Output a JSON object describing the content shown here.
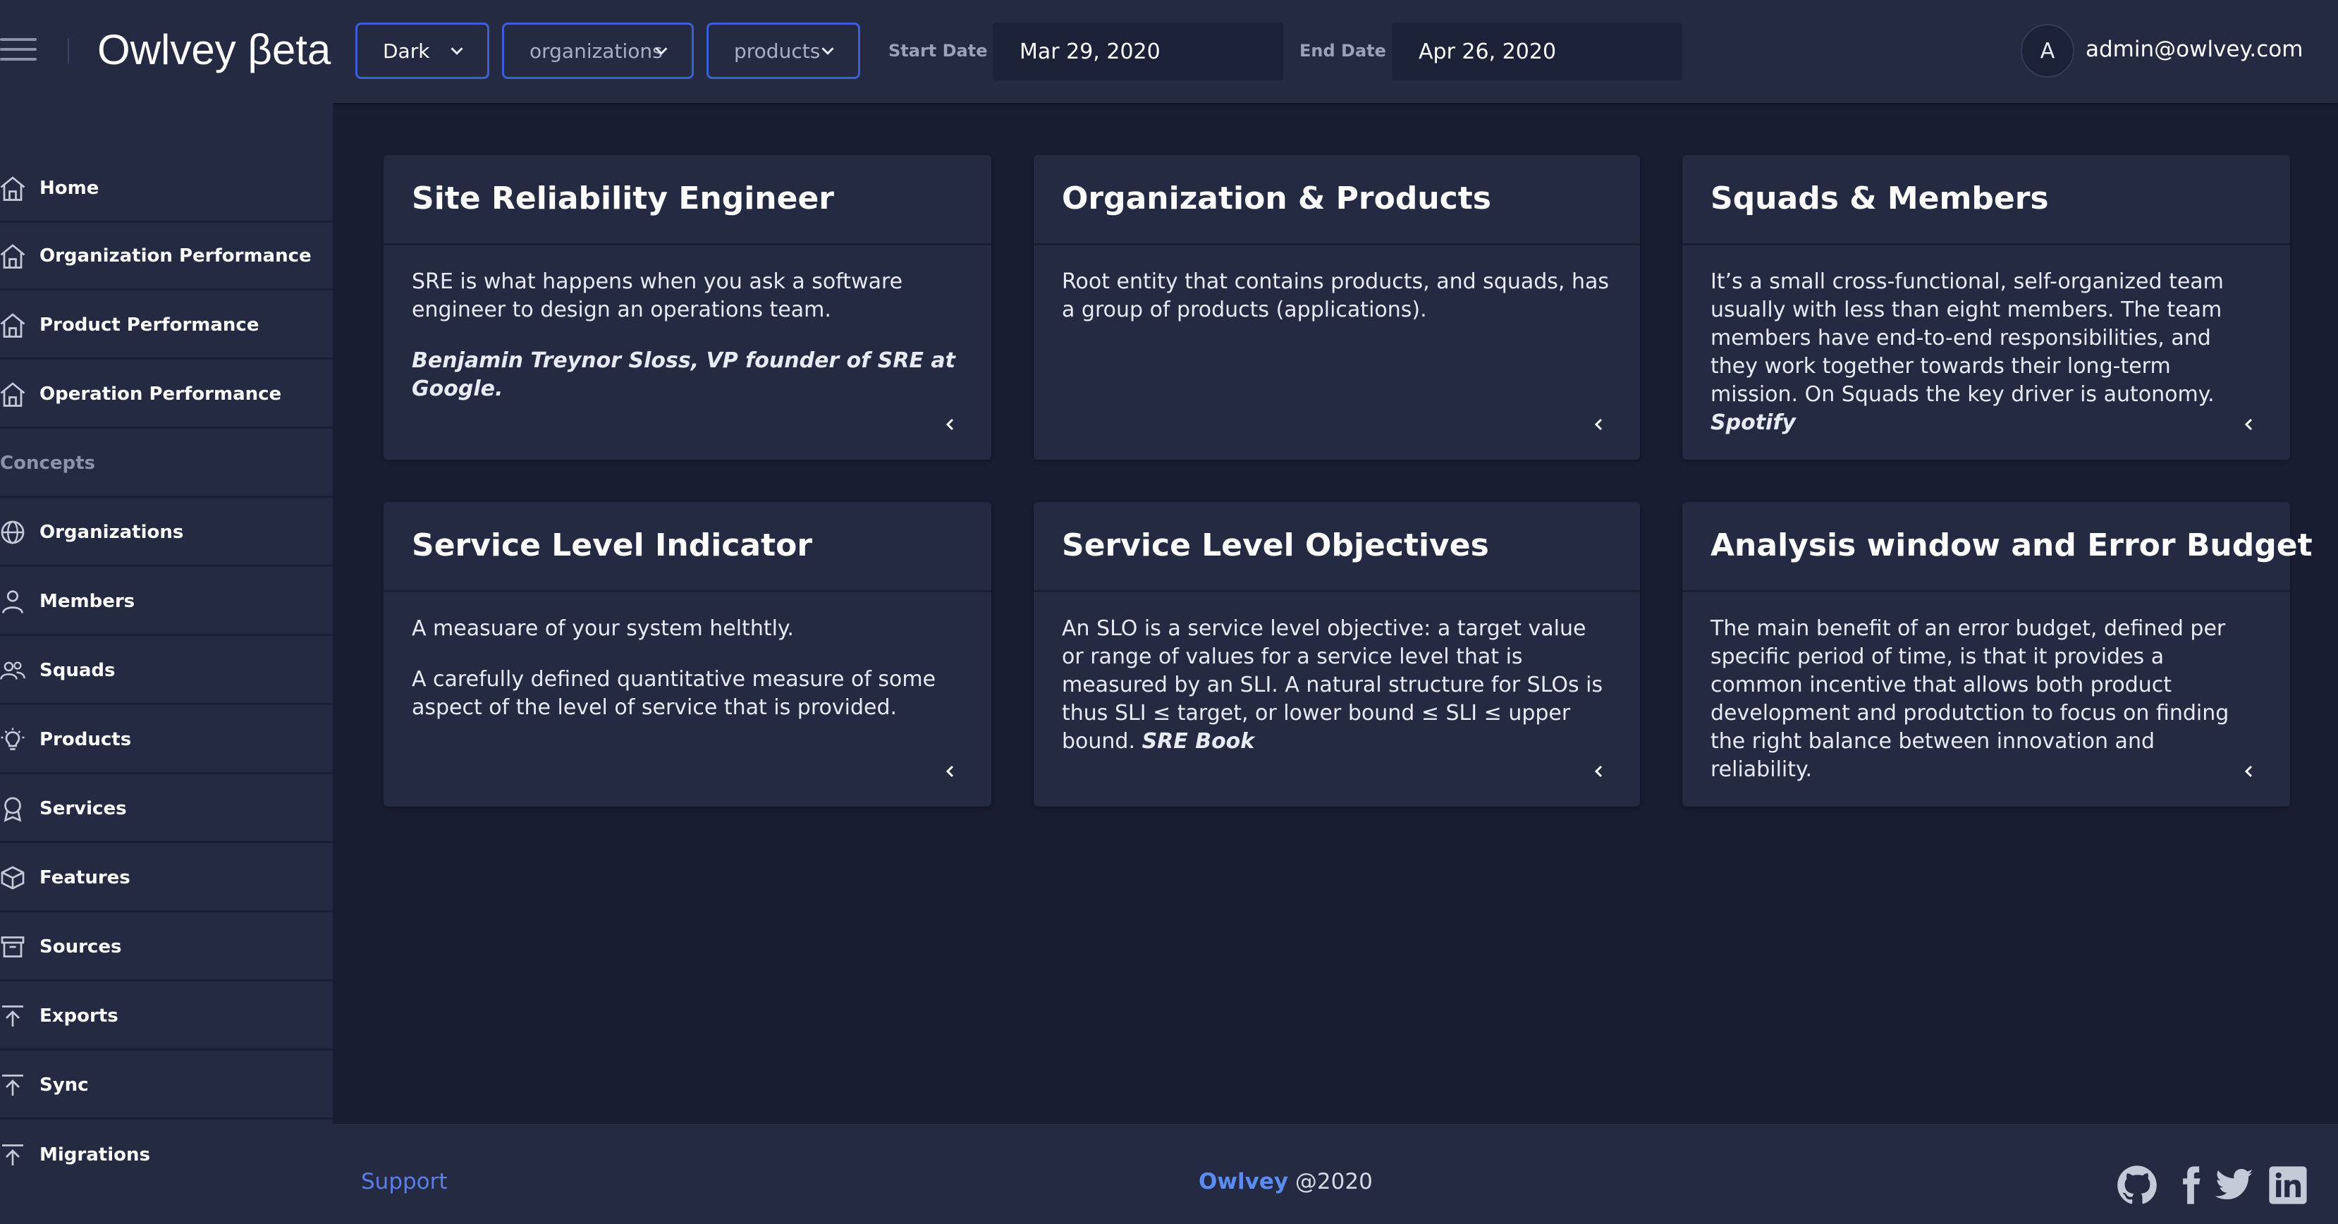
{
  "header": {
    "brand": "Owlvey βeta",
    "theme_select": "Dark",
    "org_select": "organizations",
    "product_select": "products",
    "start_label": "Start Date",
    "start_value": "Mar 29, 2020",
    "end_label": "End Date",
    "end_value": "Apr 26, 2020",
    "avatar_initial": "A",
    "user_email": "admin@owlvey.com"
  },
  "sidebar": {
    "items": [
      {
        "label": "Home",
        "icon": "home-icon"
      },
      {
        "label": "Organization Performance",
        "icon": "home-icon"
      },
      {
        "label": "Product Performance",
        "icon": "home-icon"
      },
      {
        "label": "Operation Performance",
        "icon": "home-icon"
      }
    ],
    "section": "Concepts",
    "concepts": [
      {
        "label": "Organizations",
        "icon": "globe-icon"
      },
      {
        "label": "Members",
        "icon": "person-icon"
      },
      {
        "label": "Squads",
        "icon": "people-icon"
      },
      {
        "label": "Products",
        "icon": "bulb-icon"
      },
      {
        "label": "Services",
        "icon": "award-icon"
      },
      {
        "label": "Features",
        "icon": "cube-icon"
      },
      {
        "label": "Sources",
        "icon": "archive-icon"
      },
      {
        "label": "Exports",
        "icon": "upload-icon"
      },
      {
        "label": "Sync",
        "icon": "upload-icon"
      },
      {
        "label": "Migrations",
        "icon": "upload-icon"
      }
    ]
  },
  "cards": [
    {
      "title": "Site Reliability Engineer",
      "p1": "SRE is what happens when you ask a software engineer to design an operations team.",
      "quote": "Benjamin Treynor Sloss, VP founder of SRE at Google."
    },
    {
      "title": "Organization & Products",
      "p1": "Root entity that contains products, and squads, has a group of products (applications)."
    },
    {
      "title": "Squads & Members",
      "p1": "It’s a small cross-functional, self-organized team usually with less than eight members. The team members have end-to-end responsibilities, and they work together towards their long-term mission. On Squads the key driver is autonomy.",
      "cite": "Spotify"
    },
    {
      "title": "Service Level Indicator",
      "p1": "A measuare of your system helthtly.",
      "p2": "A carefully defined quantitative measure of some aspect of the level of service that is provided."
    },
    {
      "title": "Service Level Objectives",
      "p1": "An SLO is a service level objective: a target value or range of values for a service level that is measured by an SLI. A natural structure for SLOs is thus SLI ≤ target, or lower bound ≤ SLI ≤ upper bound.",
      "cite": "SRE Book"
    },
    {
      "title": "Analysis window and Error Budget",
      "p1": "The main benefit of an error budget, defined per specific period of time, is that it provides a common incentive that allows both product development and produtction to focus on finding the right balance between innovation and reliability."
    }
  ],
  "footer": {
    "support": "Support",
    "brand": "Owlvey",
    "year": "@2020",
    "social": [
      "github-icon",
      "facebook-icon",
      "twitter-icon",
      "linkedin-icon"
    ]
  },
  "colors": {
    "accent": "#3b60d6",
    "link": "#5b7ee5",
    "panel": "#232a42",
    "background": "#181d31"
  }
}
